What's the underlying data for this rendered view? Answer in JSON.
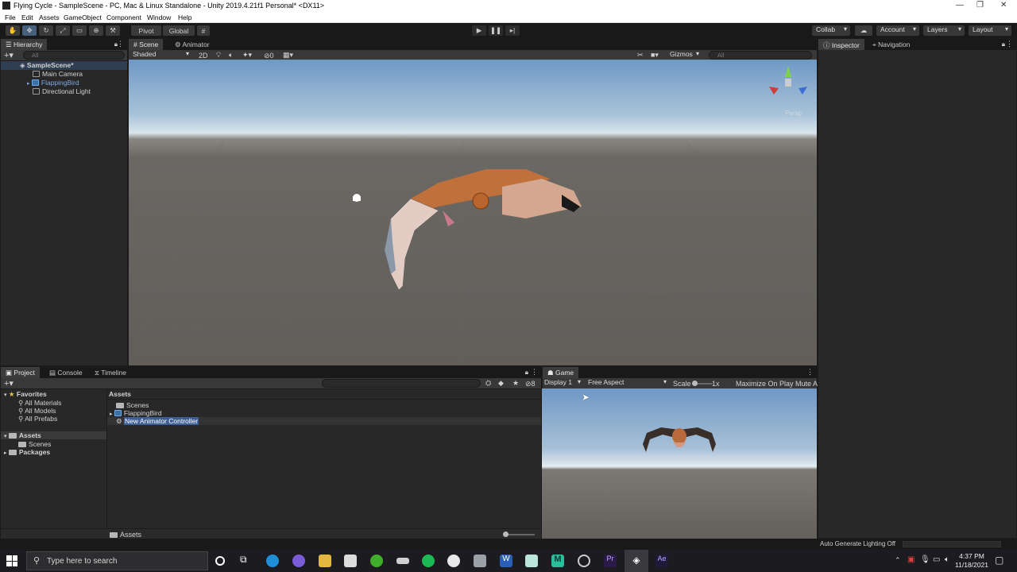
{
  "window": {
    "title": "Flying Cycle - SampleScene - PC, Mac & Linux Standalone - Unity 2019.4.21f1 Personal* <DX11>"
  },
  "menu": [
    "File",
    "Edit",
    "Assets",
    "GameObject",
    "Component",
    "Window",
    "Help"
  ],
  "toolbar": {
    "pivot": "Pivot",
    "global": "Global",
    "collab": "Collab",
    "account": "Account",
    "layers": "Layers",
    "layout": "Layout"
  },
  "hierarchy": {
    "tab": "Hierarchy",
    "search_placeholder": "All",
    "scene": "SampleScene*",
    "items": [
      "Main Camera",
      "FlappingBird",
      "Directional Light"
    ]
  },
  "scene": {
    "tabs": [
      "Scene",
      "Animator"
    ],
    "shading": "Shaded",
    "mode_2d": "2D",
    "hidden_count": "0",
    "gizmos": "Gizmos",
    "search_placeholder": "All",
    "persp": "Persp"
  },
  "inspector": {
    "tabs": [
      "Inspector",
      "Navigation"
    ]
  },
  "project": {
    "tabs": [
      "Project",
      "Console",
      "Timeline"
    ],
    "favorites_label": "Favorites",
    "favorites": [
      "All Materials",
      "All Models",
      "All Prefabs"
    ],
    "assets_label": "Assets",
    "assets_children": [
      "Scenes"
    ],
    "packages_label": "Packages",
    "breadcrumb": "Assets",
    "files": [
      "Scenes",
      "FlappingBird",
      "New Animator Controller"
    ],
    "count": "8",
    "footer_path": "Assets"
  },
  "game": {
    "tab": "Game",
    "display": "Display 1",
    "aspect": "Free Aspect",
    "scale_label": "Scale",
    "scale_value": "1x",
    "maximize": "Maximize On Play",
    "mute": "Mute A"
  },
  "status": {
    "lighting": "Auto Generate Lighting Off"
  },
  "taskbar": {
    "search_placeholder": "Type here to search",
    "time": "4:37 PM",
    "date": "11/18/2021"
  },
  "colors": {
    "selection": "#3e5f96",
    "accent_blue": "#46607c",
    "panel": "#282828"
  }
}
